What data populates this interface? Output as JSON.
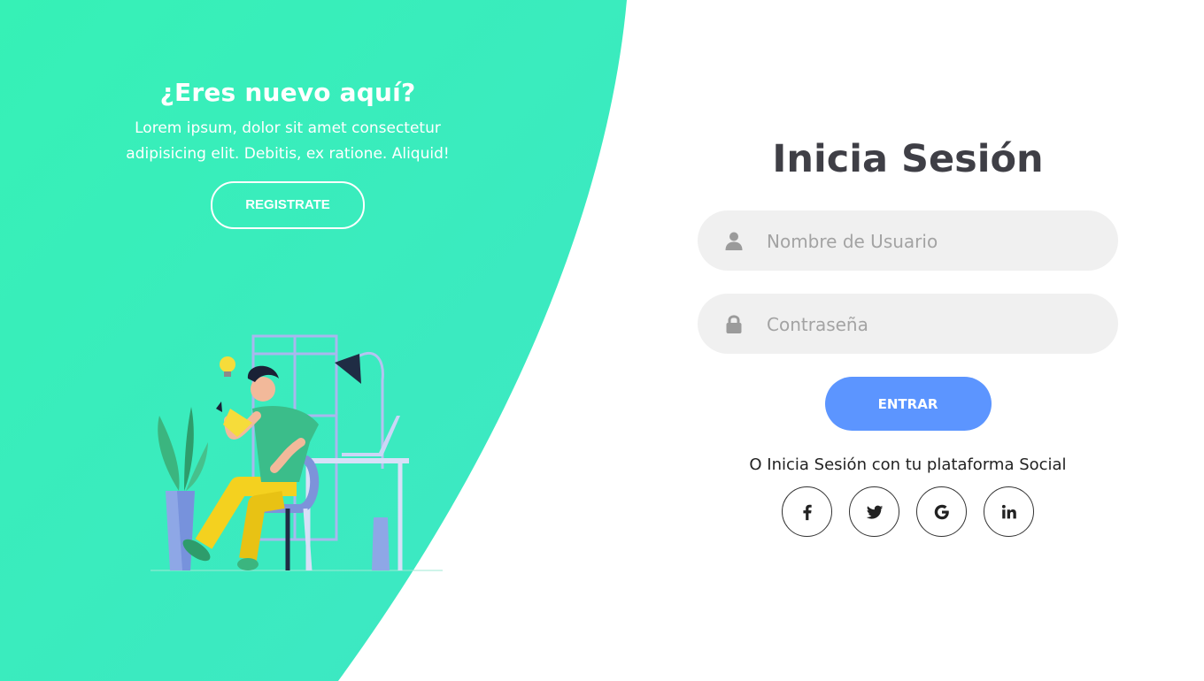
{
  "left_panel": {
    "title": "¿Eres nuevo aquí?",
    "text_line1": "Lorem ipsum, dolor sit amet consectetur",
    "text_line2": "adipisicing elit. Debitis, ex ratione. Aliquid!",
    "register_label": "REGISTRATE",
    "accent_color": "#3be8b0"
  },
  "login_form": {
    "title": "Inicia Sesión",
    "username": {
      "placeholder": "Nombre de Usuario",
      "value": "",
      "icon": "user-icon"
    },
    "password": {
      "placeholder": "Contraseña",
      "value": "",
      "icon": "lock-icon"
    },
    "submit_label": "ENTRAR",
    "submit_color": "#5c95ff"
  },
  "social": {
    "text": "O Inicia Sesión con tu plataforma Social",
    "platforms": [
      {
        "icon": "facebook-icon",
        "glyph": "f"
      },
      {
        "icon": "twitter-icon"
      },
      {
        "icon": "google-icon",
        "glyph": "G"
      },
      {
        "icon": "linkedin-icon",
        "glyph": "in"
      }
    ]
  }
}
